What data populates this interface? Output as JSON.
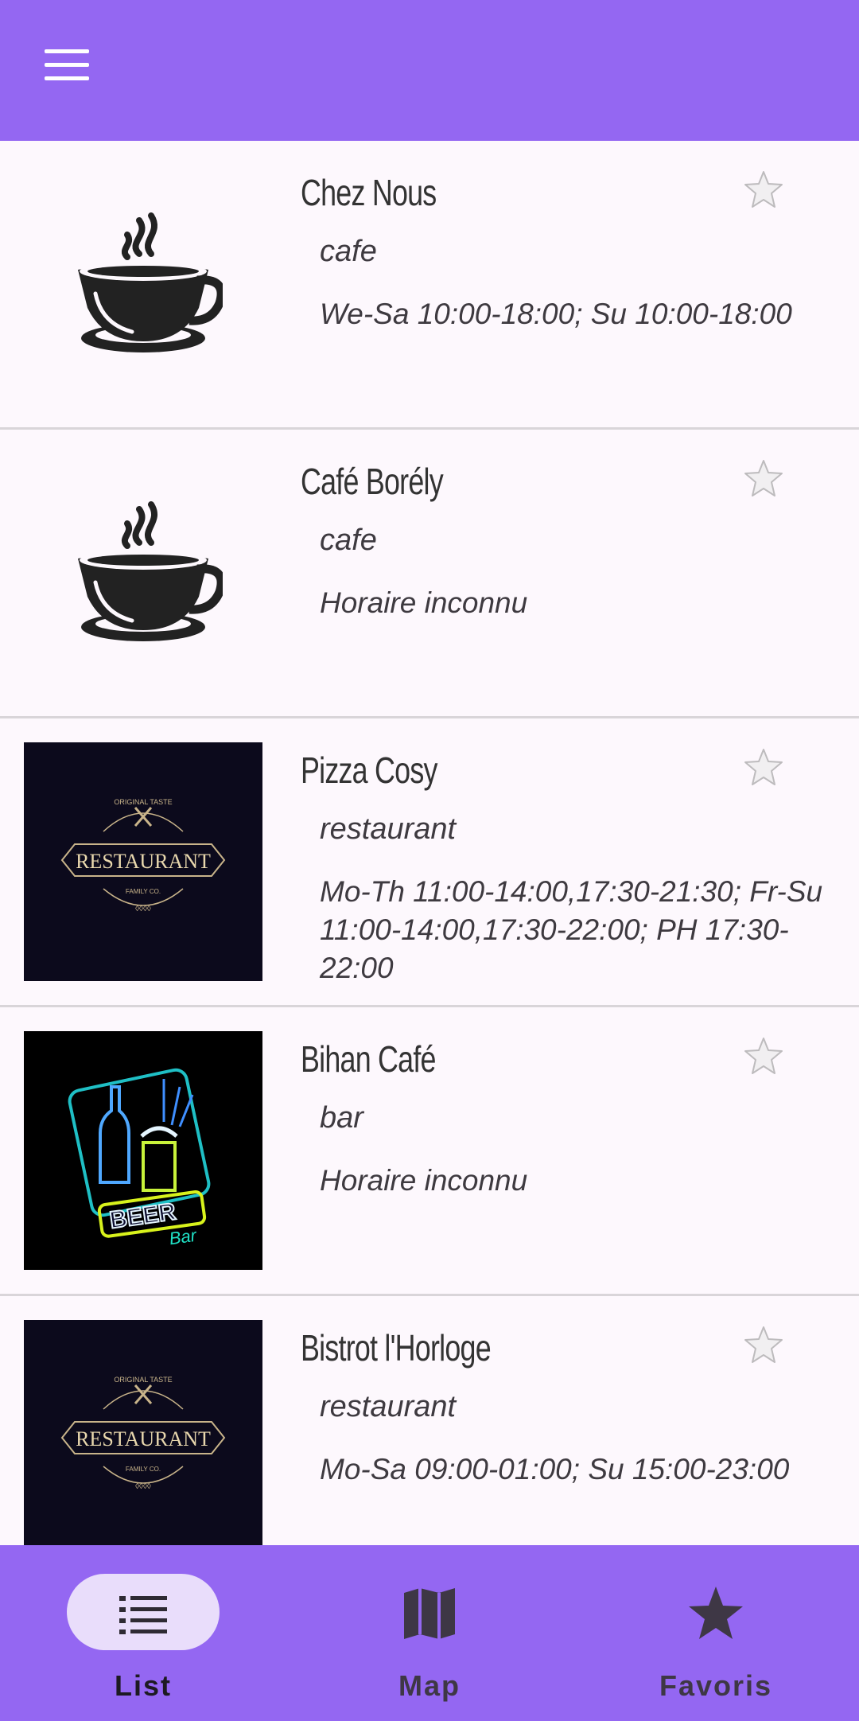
{
  "colors": {
    "primary": "#9467f2",
    "background": "#fdf8fd",
    "active_pill": "#e9ddfb"
  },
  "items": [
    {
      "name": "Chez Nous",
      "category": "cafe",
      "hours": "We-Sa 10:00-18:00; Su 10:00-18:00",
      "image": "coffee-cup-icon"
    },
    {
      "name": "Café Borély",
      "category": "cafe",
      "hours": "Horaire inconnu",
      "image": "coffee-cup-icon"
    },
    {
      "name": "Pizza Cosy",
      "category": "restaurant",
      "hours": "Mo-Th 11:00-14:00,17:30-21:30; Fr-Su 11:00-14:00,17:30-22:00; PH 17:30-22:00",
      "image": "restaurant-logo"
    },
    {
      "name": "Bihan Café",
      "category": "bar",
      "hours": "Horaire inconnu",
      "image": "beer-bar-neon"
    },
    {
      "name": "Bistrot l'Horloge",
      "category": "restaurant",
      "hours": "Mo-Sa 09:00-01:00; Su 15:00-23:00",
      "image": "restaurant-logo"
    }
  ],
  "logo": {
    "original_taste": "ORIGINAL TASTE",
    "restaurant": "RESTAURANT",
    "family_co": "FAMILY CO.",
    "beer": "BEER",
    "bar": "Bar"
  },
  "nav": [
    {
      "label": "List",
      "icon": "list-icon",
      "active": true
    },
    {
      "label": "Map",
      "icon": "map-icon",
      "active": false
    },
    {
      "label": "Favoris",
      "icon": "star-icon",
      "active": false
    }
  ]
}
